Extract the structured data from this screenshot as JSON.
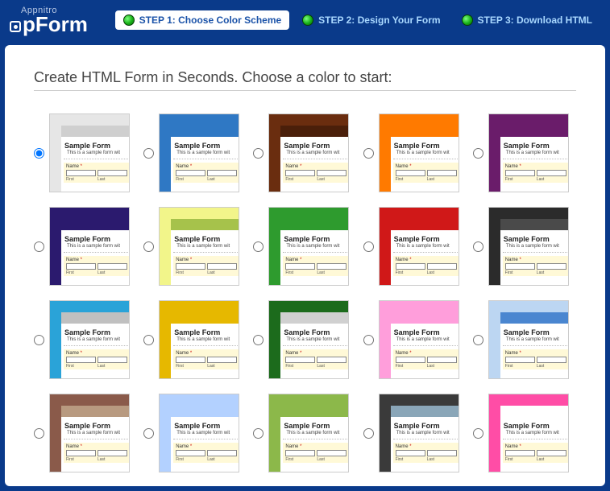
{
  "logo": {
    "top": "Appnitro",
    "text": "pForm"
  },
  "steps": [
    {
      "label": "STEP 1: Choose Color Scheme",
      "active": true
    },
    {
      "label": "STEP 2: Design Your Form",
      "active": false
    },
    {
      "label": "STEP 3: Download HTML",
      "active": false
    }
  ],
  "heading": "Create HTML Form in Seconds. Choose a color to start:",
  "sample": {
    "title": "Sample Form",
    "sub": "This is a sample form wit",
    "fieldLabel": "Name",
    "req": "*",
    "first": "First",
    "last": "Last"
  },
  "themes": [
    {
      "outer": "#e6e6e6",
      "hdr": "#cfcfcf",
      "selected": true
    },
    {
      "outer": "#2f78c4",
      "hdr": "#2f78c4"
    },
    {
      "outer": "#6a2d0f",
      "hdr": "#4a1f0a"
    },
    {
      "outer": "#ff7a00",
      "hdr": "#ff7a00"
    },
    {
      "outer": "#6a1c6a",
      "hdr": "#6a1c6a"
    },
    {
      "outer": "#2b1a6e",
      "hdr": "#2b1a6e"
    },
    {
      "outer": "#f2f58a",
      "hdr": "#a6c24b"
    },
    {
      "outer": "#2e9b2e",
      "hdr": "#2e9b2e"
    },
    {
      "outer": "#d01818",
      "hdr": "#d01818"
    },
    {
      "outer": "#2b2b2b",
      "hdr": "#4a4a4a"
    },
    {
      "outer": "#2aa3d8",
      "hdr": "#c0c0c0"
    },
    {
      "outer": "#e6b800",
      "hdr": "#e6b800"
    },
    {
      "outer": "#1c6b1c",
      "hdr": "#d0d0d0"
    },
    {
      "outer": "#ff9edb",
      "hdr": "#ff9edb"
    },
    {
      "outer": "#bcd6f2",
      "hdr": "#4a86d0"
    },
    {
      "outer": "#8a5a4a",
      "hdr": "#b89a80"
    },
    {
      "outer": "#b3d1ff",
      "hdr": "#b3d1ff"
    },
    {
      "outer": "#8cb84a",
      "hdr": "#8cb84a"
    },
    {
      "outer": "#3a3a3a",
      "hdr": "#8aa6b8"
    },
    {
      "outer": "#ff4da6",
      "hdr": "#ffffff"
    }
  ]
}
